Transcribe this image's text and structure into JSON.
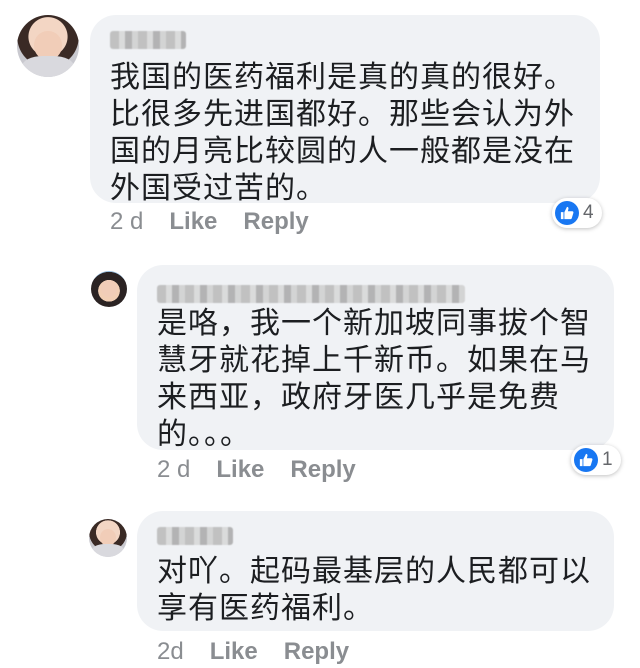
{
  "comments": [
    {
      "text_lines": [
        "我国的医药福利是真的真的很好。",
        "比很多先进国都好。那些会认为外",
        "国的月亮比较圆的人一般都是没在",
        "外国受过苦的。"
      ],
      "time": "2 d",
      "like_label": "Like",
      "reply_label": "Reply",
      "reaction_count": "4"
    },
    {
      "text_lines": [
        "是咯，我一个新加坡同事拔个智",
        "慧牙就花掉上千新币。如果在马",
        "来西亚，政府牙医几乎是免费",
        "的。。。"
      ],
      "time": "2 d",
      "like_label": "Like",
      "reply_label": "Reply",
      "reaction_count": "1"
    },
    {
      "text_lines": [
        "对吖。起码最基层的人民都可以",
        "享有医药福利。"
      ],
      "time": "2d",
      "like_label": "Like",
      "reply_label": "Reply"
    }
  ],
  "colors": {
    "bubble": "#f0f2f5",
    "text": "#1c1e21",
    "meta": "#8a8d91",
    "like_blue": "#1877f2"
  },
  "icons": {
    "avatar": "user-avatar",
    "reaction": "thumbs-up-icon"
  }
}
